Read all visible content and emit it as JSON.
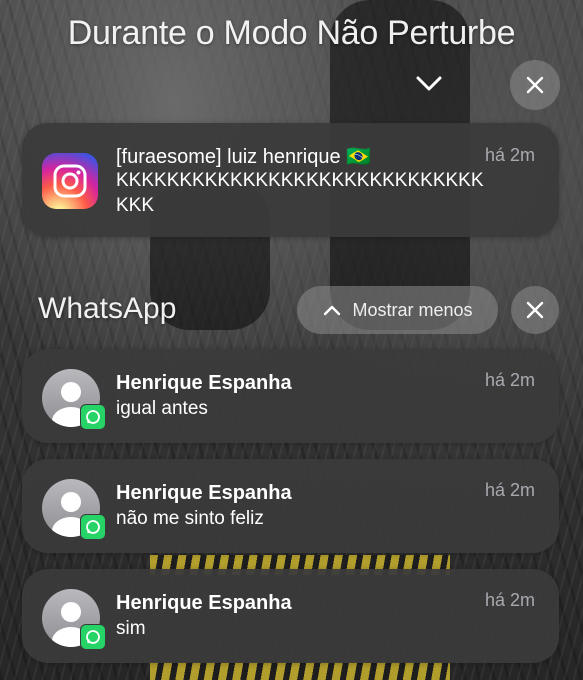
{
  "focus": {
    "title": "Durante o Modo Não Perturbe"
  },
  "instagram_notification": {
    "title": "[furaesome] luiz henrique 🇧🇷",
    "time": "há 2m",
    "body_line1": "KKKKKKKKKKKKKKKKKKKKKKKKKKKKK",
    "body_line2": "KKK",
    "icon": "instagram-icon"
  },
  "whatsapp_group": {
    "label": "WhatsApp",
    "show_less": "Mostrar menos",
    "notifications": [
      {
        "sender": "Henrique Espanha",
        "time": "há 2m",
        "message": "igual antes"
      },
      {
        "sender": "Henrique Espanha",
        "time": "há 2m",
        "message": "não me sinto feliz"
      },
      {
        "sender": "Henrique Espanha",
        "time": "há 2m",
        "message": "sim"
      }
    ]
  },
  "colors": {
    "card_bg": "#3a3a3c",
    "whatsapp_green": "#25d366",
    "secondary_text": "#a0a0a8"
  }
}
